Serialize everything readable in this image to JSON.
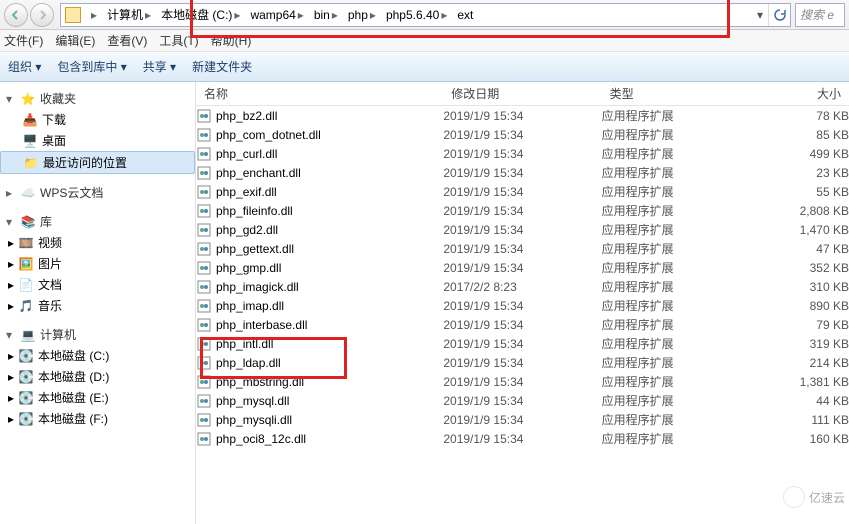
{
  "nav": {
    "back": "←",
    "forward": "→"
  },
  "breadcrumbs": [
    {
      "label": "计算机",
      "sep": "▸"
    },
    {
      "label": "本地磁盘 (C:)",
      "sep": "▸"
    },
    {
      "label": "wamp64",
      "sep": "▸"
    },
    {
      "label": "bin",
      "sep": "▸"
    },
    {
      "label": "php",
      "sep": "▸"
    },
    {
      "label": "php5.6.40",
      "sep": "▸"
    },
    {
      "label": "ext",
      "sep": ""
    }
  ],
  "addr_dropdown": "▾",
  "search_placeholder": "搜索 e",
  "menu": [
    {
      "label": "文件(F)"
    },
    {
      "label": "编辑(E)"
    },
    {
      "label": "查看(V)"
    },
    {
      "label": "工具(T)"
    },
    {
      "label": "帮助(H)"
    }
  ],
  "toolbar": {
    "organize": "组织 ▾",
    "include": "包含到库中 ▾",
    "share": "共享 ▾",
    "newfolder": "新建文件夹"
  },
  "sidebar": {
    "fav_head": "收藏夹",
    "downloads": "下载",
    "desktop": "桌面",
    "recent": "最近访问的位置",
    "wps_head": "WPS云文档",
    "lib_head": "库",
    "video": "视频",
    "picture": "图片",
    "doc": "文档",
    "music": "音乐",
    "pc_head": "计算机",
    "drive_c": "本地磁盘 (C:)",
    "drive_d": "本地磁盘 (D:)",
    "drive_e": "本地磁盘 (E:)",
    "drive_f": "本地磁盘 (F:)"
  },
  "columns": {
    "name": "名称",
    "date": "修改日期",
    "type": "类型",
    "size": "大小"
  },
  "file_type": "应用程序扩展",
  "files": [
    {
      "name": "php_bz2.dll",
      "date": "2019/1/9 15:34",
      "size": "78 KB"
    },
    {
      "name": "php_com_dotnet.dll",
      "date": "2019/1/9 15:34",
      "size": "85 KB"
    },
    {
      "name": "php_curl.dll",
      "date": "2019/1/9 15:34",
      "size": "499 KB"
    },
    {
      "name": "php_enchant.dll",
      "date": "2019/1/9 15:34",
      "size": "23 KB"
    },
    {
      "name": "php_exif.dll",
      "date": "2019/1/9 15:34",
      "size": "55 KB"
    },
    {
      "name": "php_fileinfo.dll",
      "date": "2019/1/9 15:34",
      "size": "2,808 KB"
    },
    {
      "name": "php_gd2.dll",
      "date": "2019/1/9 15:34",
      "size": "1,470 KB"
    },
    {
      "name": "php_gettext.dll",
      "date": "2019/1/9 15:34",
      "size": "47 KB"
    },
    {
      "name": "php_gmp.dll",
      "date": "2019/1/9 15:34",
      "size": "352 KB"
    },
    {
      "name": "php_imagick.dll",
      "date": "2017/2/2 8:23",
      "size": "310 KB"
    },
    {
      "name": "php_imap.dll",
      "date": "2019/1/9 15:34",
      "size": "890 KB"
    },
    {
      "name": "php_interbase.dll",
      "date": "2019/1/9 15:34",
      "size": "79 KB"
    },
    {
      "name": "php_intl.dll",
      "date": "2019/1/9 15:34",
      "size": "319 KB"
    },
    {
      "name": "php_ldap.dll",
      "date": "2019/1/9 15:34",
      "size": "214 KB"
    },
    {
      "name": "php_mbstring.dll",
      "date": "2019/1/9 15:34",
      "size": "1,381 KB"
    },
    {
      "name": "php_mysql.dll",
      "date": "2019/1/9 15:34",
      "size": "44 KB"
    },
    {
      "name": "php_mysqli.dll",
      "date": "2019/1/9 15:34",
      "size": "111 KB"
    },
    {
      "name": "php_oci8_12c.dll",
      "date": "2019/1/9 15:34",
      "size": "160 KB"
    }
  ],
  "watermark": "亿速云"
}
